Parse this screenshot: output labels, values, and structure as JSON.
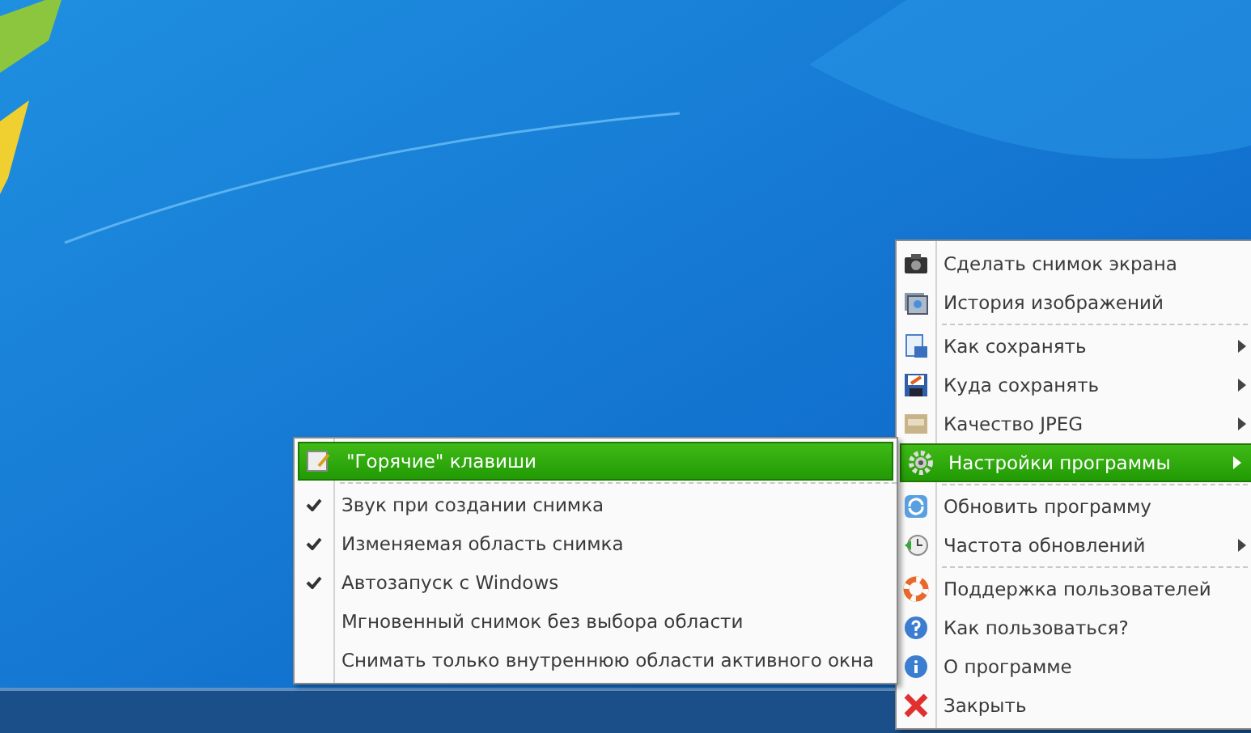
{
  "main_menu": {
    "items": [
      {
        "label": "Сделать снимок экрана",
        "has_submenu": false,
        "selected": false,
        "separator_before": false
      },
      {
        "label": "История изображений",
        "has_submenu": false,
        "selected": false,
        "separator_before": false
      },
      {
        "label": "Как сохранять",
        "has_submenu": true,
        "selected": false,
        "separator_before": true
      },
      {
        "label": "Куда сохранять",
        "has_submenu": true,
        "selected": false,
        "separator_before": false
      },
      {
        "label": "Качество JPEG",
        "has_submenu": true,
        "selected": false,
        "separator_before": false
      },
      {
        "label": "Настройки программы",
        "has_submenu": true,
        "selected": true,
        "separator_before": false
      },
      {
        "label": "Обновить программу",
        "has_submenu": false,
        "selected": false,
        "separator_before": true
      },
      {
        "label": "Частота обновлений",
        "has_submenu": true,
        "selected": false,
        "separator_before": false
      },
      {
        "label": "Поддержка пользователей",
        "has_submenu": false,
        "selected": false,
        "separator_before": true
      },
      {
        "label": "Как пользоваться?",
        "has_submenu": false,
        "selected": false,
        "separator_before": false
      },
      {
        "label": "О программе",
        "has_submenu": false,
        "selected": false,
        "separator_before": false
      },
      {
        "label": "Закрыть",
        "has_submenu": false,
        "selected": false,
        "separator_before": false
      }
    ]
  },
  "settings_submenu": {
    "items": [
      {
        "kind": "header",
        "label": "\"Горячие\" клавиши",
        "selected": true
      },
      {
        "kind": "check",
        "label": "Звук при создании снимка",
        "checked": true,
        "selected": false
      },
      {
        "kind": "check",
        "label": "Изменяемая область снимка",
        "checked": true,
        "selected": false
      },
      {
        "kind": "check",
        "label": "Автозапуск с Windows",
        "checked": true,
        "selected": false
      },
      {
        "kind": "check",
        "label": "Мгновенный снимок без выбора области",
        "checked": false,
        "selected": false
      },
      {
        "kind": "check",
        "label": "Снимать только внутреннюю области активного окна",
        "checked": false,
        "selected": false
      }
    ]
  }
}
